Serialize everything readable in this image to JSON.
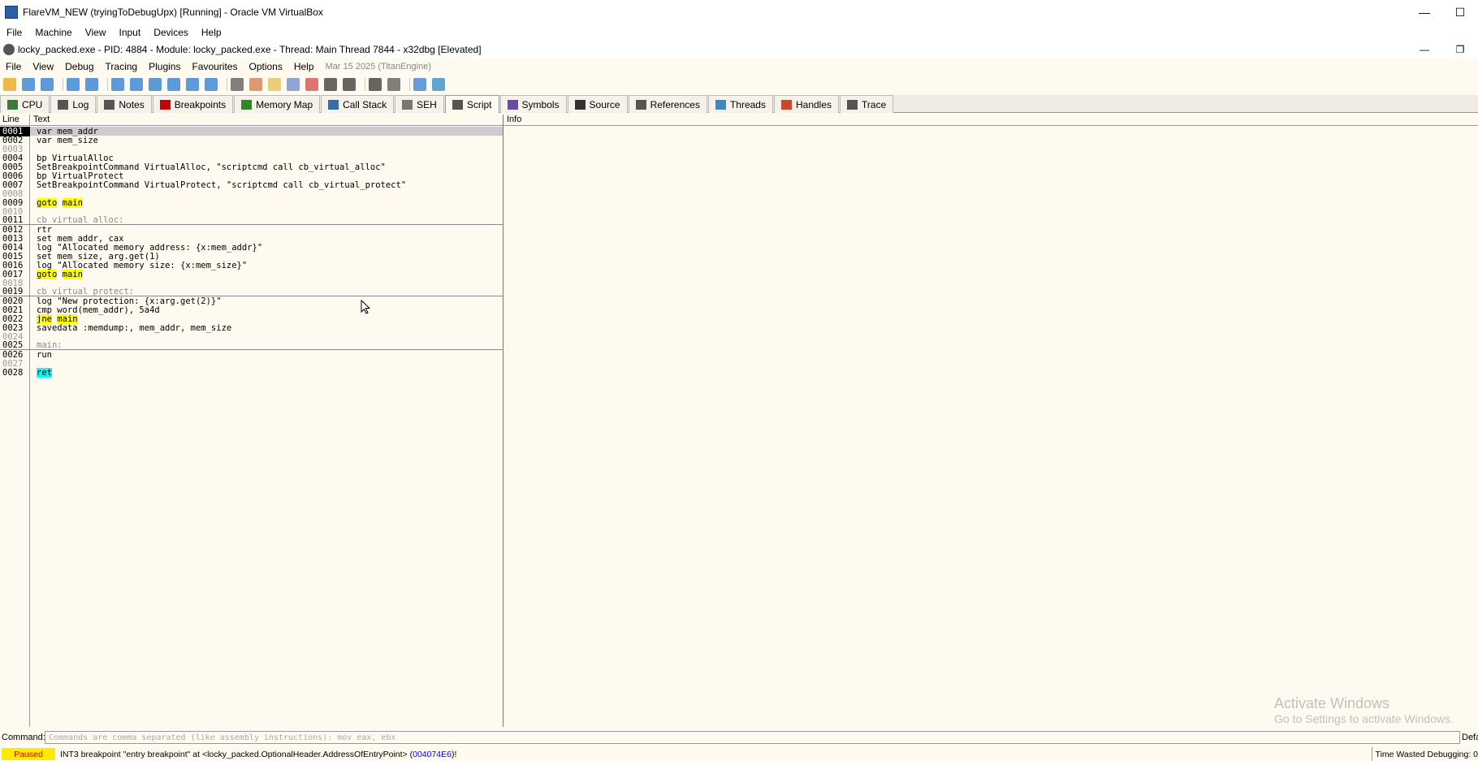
{
  "vbox": {
    "title": "FlareVM_NEW (tryingToDebugUpx) [Running] - Oracle VM VirtualBox",
    "menu": [
      "File",
      "Machine",
      "View",
      "Input",
      "Devices",
      "Help"
    ]
  },
  "x64dbg": {
    "title": "locky_packed.exe - PID: 4884 - Module: locky_packed.exe - Thread: Main Thread 7844 - x32dbg [Elevated]",
    "menu": [
      "File",
      "View",
      "Debug",
      "Tracing",
      "Plugins",
      "Favourites",
      "Options",
      "Help"
    ],
    "date": "Mar 15 2025 (TitanEngine)"
  },
  "toolbar_icons": [
    "open-icon",
    "restart-icon",
    "stop-icon",
    "run-icon",
    "pause-icon",
    "step-into-icon",
    "step-over-icon",
    "trace-into-icon",
    "trace-over-icon",
    "execute-till-return-icon",
    "run-to-user-code-icon",
    "scylla-icon",
    "patches-icon",
    "comments-icon",
    "labels-icon",
    "bookmarks-icon",
    "functions-icon",
    "hash-icon",
    "string-icon",
    "calculator-icon",
    "preferences-icon",
    "globe-icon"
  ],
  "tabs": [
    {
      "label": "CPU",
      "icon": "cpu-icon",
      "color": "#3a7a3a"
    },
    {
      "label": "Log",
      "icon": "log-icon",
      "color": "#555"
    },
    {
      "label": "Notes",
      "icon": "notes-icon",
      "color": "#555"
    },
    {
      "label": "Breakpoints",
      "icon": "breakpoint-icon",
      "color": "#cc0000"
    },
    {
      "label": "Memory Map",
      "icon": "memory-map-icon",
      "color": "#2a8a2a"
    },
    {
      "label": "Call Stack",
      "icon": "call-stack-icon",
      "color": "#3a6aa8"
    },
    {
      "label": "SEH",
      "icon": "seh-icon",
      "color": "#777"
    },
    {
      "label": "Script",
      "icon": "script-icon",
      "color": "#555"
    },
    {
      "label": "Symbols",
      "icon": "symbols-icon",
      "color": "#6a4aa8"
    },
    {
      "label": "Source",
      "icon": "source-icon",
      "color": "#333"
    },
    {
      "label": "References",
      "icon": "references-icon",
      "color": "#555"
    },
    {
      "label": "Threads",
      "icon": "threads-icon",
      "color": "#3a8ac8"
    },
    {
      "label": "Handles",
      "icon": "handles-icon",
      "color": "#c84a2a"
    },
    {
      "label": "Trace",
      "icon": "trace-icon",
      "color": "#555"
    }
  ],
  "active_tab": "Script",
  "script_columns": {
    "line": "Line",
    "text": "Text",
    "info": "Info"
  },
  "script_lines": [
    {
      "n": "0001",
      "parts": [
        {
          "t": "var mem_addr"
        }
      ],
      "sel": true
    },
    {
      "n": "0002",
      "parts": [
        {
          "t": "var mem_size"
        }
      ]
    },
    {
      "n": "0003",
      "parts": [],
      "empty": true
    },
    {
      "n": "0004",
      "parts": [
        {
          "t": "bp VirtualAlloc"
        }
      ]
    },
    {
      "n": "0005",
      "parts": [
        {
          "t": "SetBreakpointCommand VirtualAlloc, \"scriptcmd call cb_virtual_alloc\""
        }
      ]
    },
    {
      "n": "0006",
      "parts": [
        {
          "t": "bp VirtualProtect"
        }
      ]
    },
    {
      "n": "0007",
      "parts": [
        {
          "t": "SetBreakpointCommand VirtualProtect, \"scriptcmd call cb_virtual_protect\""
        }
      ]
    },
    {
      "n": "0008",
      "parts": [],
      "empty": true
    },
    {
      "n": "0009",
      "parts": [
        {
          "t": "goto",
          "h": "y"
        },
        {
          "t": " "
        },
        {
          "t": "main",
          "h": "y"
        }
      ]
    },
    {
      "n": "0010",
      "parts": [],
      "empty": true
    },
    {
      "n": "0011",
      "parts": [
        {
          "t": "cb_virtual_alloc:"
        }
      ],
      "label": true
    },
    {
      "n": "0012",
      "parts": [
        {
          "t": "rtr"
        }
      ]
    },
    {
      "n": "0013",
      "parts": [
        {
          "t": "set mem_addr, cax"
        }
      ]
    },
    {
      "n": "0014",
      "parts": [
        {
          "t": "log \"Allocated memory address: {x:mem_addr}\""
        }
      ]
    },
    {
      "n": "0015",
      "parts": [
        {
          "t": "set mem_size, arg.get(1)"
        }
      ]
    },
    {
      "n": "0016",
      "parts": [
        {
          "t": "log \"Allocated memory size: {x:mem_size}\""
        }
      ]
    },
    {
      "n": "0017",
      "parts": [
        {
          "t": "goto",
          "h": "y"
        },
        {
          "t": " "
        },
        {
          "t": "main",
          "h": "y"
        }
      ]
    },
    {
      "n": "0018",
      "parts": [],
      "empty": true
    },
    {
      "n": "0019",
      "parts": [
        {
          "t": "cb_virtual_protect:"
        }
      ],
      "label": true
    },
    {
      "n": "0020",
      "parts": [
        {
          "t": "log \"New protection: {x:arg.get(2)}\""
        }
      ]
    },
    {
      "n": "0021",
      "parts": [
        {
          "t": "cmp word(mem_addr), 5a4d"
        }
      ]
    },
    {
      "n": "0022",
      "parts": [
        {
          "t": "jne",
          "h": "y"
        },
        {
          "t": " "
        },
        {
          "t": "main",
          "h": "y"
        }
      ]
    },
    {
      "n": "0023",
      "parts": [
        {
          "t": "savedata :memdump:, mem_addr, mem_size"
        }
      ]
    },
    {
      "n": "0024",
      "parts": [],
      "empty": true
    },
    {
      "n": "0025",
      "parts": [
        {
          "t": "main:"
        }
      ],
      "label": true
    },
    {
      "n": "0026",
      "parts": [
        {
          "t": "run"
        }
      ]
    },
    {
      "n": "0027",
      "parts": [],
      "empty": true
    },
    {
      "n": "0028",
      "parts": [
        {
          "t": "ret",
          "h": "c"
        }
      ]
    }
  ],
  "watermark": {
    "line1": "Activate Windows",
    "line2": "Go to Settings to activate Windows."
  },
  "command": {
    "label": "Command:",
    "placeholder": "Commands are comma separated (like assembly instructions): mov eax, ebx",
    "right": "Defa"
  },
  "status": {
    "state": "Paused",
    "message_prefix": "INT3 breakpoint \"entry breakpoint\" at <locky_packed.OptionalHeader.AddressOfEntryPoint> (",
    "address": "004074E6",
    "message_suffix": ")!",
    "time": "Time Wasted Debugging: 0"
  }
}
